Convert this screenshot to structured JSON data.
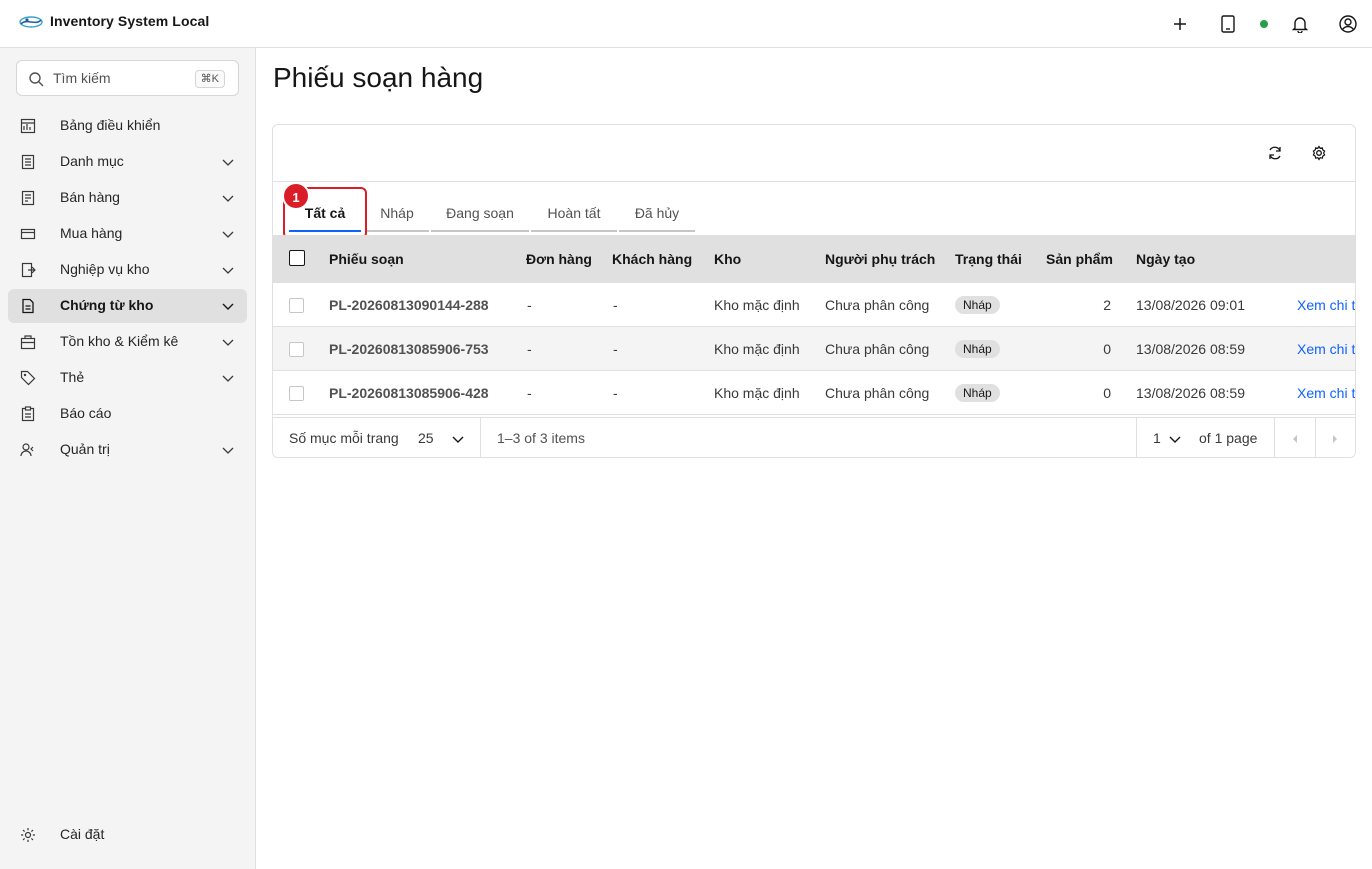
{
  "app": {
    "title": "Inventory System Local"
  },
  "colors": {
    "accent": "#0f62fe",
    "status_online": "#24a148",
    "highlight": "#da1e28"
  },
  "header_icons": [
    "add-icon",
    "tablet-icon",
    "notification-icon",
    "user-avatar-icon"
  ],
  "sidebar": {
    "search": {
      "placeholder": "Tìm kiếm",
      "shortcut": "⌘K"
    },
    "items": [
      {
        "label": "Bảng điều khiển",
        "icon": "dashboard-icon",
        "expandable": false
      },
      {
        "label": "Danh mục",
        "icon": "catalog-icon",
        "expandable": true
      },
      {
        "label": "Bán hàng",
        "icon": "sales-icon",
        "expandable": true
      },
      {
        "label": "Mua hàng",
        "icon": "purchase-icon",
        "expandable": true
      },
      {
        "label": "Nghiệp vụ kho",
        "icon": "warehouse-ops-icon",
        "expandable": true
      },
      {
        "label": "Chứng từ kho",
        "icon": "document-icon",
        "expandable": true,
        "active": true
      },
      {
        "label": "Tồn kho & Kiểm kê",
        "icon": "inventory-icon",
        "expandable": true
      },
      {
        "label": "Thẻ",
        "icon": "tag-icon",
        "expandable": true
      },
      {
        "label": "Báo cáo",
        "icon": "report-icon",
        "expandable": false
      },
      {
        "label": "Quản trị",
        "icon": "admin-icon",
        "expandable": true
      }
    ],
    "settings": {
      "label": "Cài đặt",
      "icon": "gear-icon"
    }
  },
  "main": {
    "title": "Phiếu soạn hàng",
    "toolbar": {
      "icons": [
        "refresh-icon",
        "settings-icon"
      ]
    },
    "tabs": [
      {
        "label": "Tất cả",
        "active": true
      },
      {
        "label": "Nháp"
      },
      {
        "label": "Đang soạn"
      },
      {
        "label": "Hoàn tất"
      },
      {
        "label": "Đã hủy"
      }
    ],
    "annotation": "1",
    "table": {
      "columns": [
        "Phiếu soạn",
        "Đơn hàng",
        "Khách hàng",
        "Kho",
        "Người phụ trách",
        "Trạng thái",
        "Sản phẩm",
        "Ngày tạo"
      ],
      "rows": [
        {
          "id": "PL-20260813090144-288",
          "order": "-",
          "customer": "-",
          "warehouse": "Kho mặc định",
          "assignee": "Chưa phân công",
          "status": "Nháp",
          "products": "2",
          "created": "13/08/2026 09:01",
          "action": "Xem chi t"
        },
        {
          "id": "PL-20260813085906-753",
          "order": "-",
          "customer": "-",
          "warehouse": "Kho mặc định",
          "assignee": "Chưa phân công",
          "status": "Nháp",
          "products": "0",
          "created": "13/08/2026 08:59",
          "action": "Xem chi t"
        },
        {
          "id": "PL-20260813085906-428",
          "order": "-",
          "customer": "-",
          "warehouse": "Kho mặc định",
          "assignee": "Chưa phân công",
          "status": "Nháp",
          "products": "0",
          "created": "13/08/2026 08:59",
          "action": "Xem chi t"
        }
      ]
    },
    "pagination": {
      "per_page_label": "Số mục mỗi trang",
      "per_page_value": "25",
      "range_text": "1–3 of 3 items",
      "page_value": "1",
      "page_total_text": "of 1 page"
    }
  }
}
